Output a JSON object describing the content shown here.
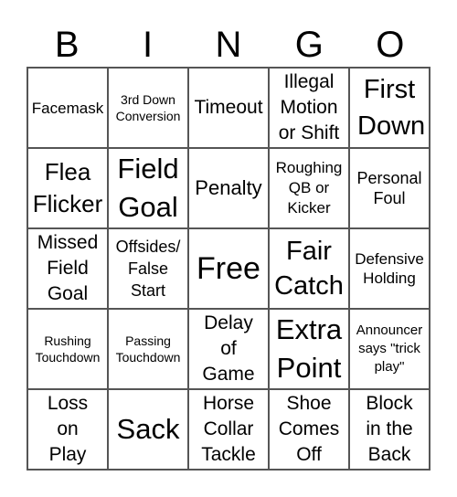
{
  "header": {
    "letters": [
      "B",
      "I",
      "N",
      "G",
      "O"
    ]
  },
  "board": {
    "cells": [
      "Facemask",
      "3rd Down Conversion",
      "Timeout",
      "Illegal Motion or Shift",
      "First Down",
      "Flea Flicker",
      "Field Goal",
      "Penalty",
      "Roughing QB or Kicker",
      "Personal Foul",
      "Missed Field Goal",
      "Offsides/ False Start",
      "Free",
      "Fair Catch",
      "Defensive Holding",
      "Rushing Touchdown",
      "Passing Touchdown",
      "Delay of Game",
      "Extra Point",
      "Announcer says \"trick play\"",
      "Loss on Play",
      "Sack",
      "Horse Collar Tackle",
      "Shoe Comes Off",
      "Block in the Back"
    ]
  }
}
